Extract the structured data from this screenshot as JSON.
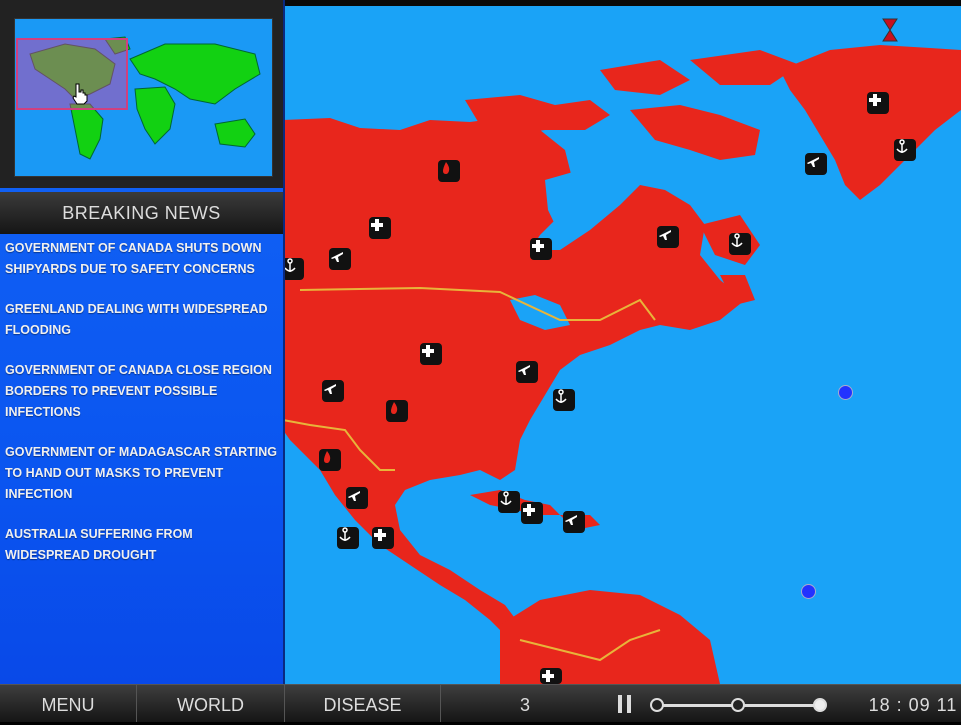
{
  "news": {
    "header": "BREAKING NEWS",
    "items": [
      "GOVERNMENT OF CANADA SHUTS DOWN SHIPYARDS DUE TO SAFETY CONCERNS",
      "GREENLAND DEALING WITH WIDESPREAD FLOODING",
      "GOVERNMENT OF CANADA CLOSE REGION BORDERS TO PREVENT POSSIBLE INFECTIONS",
      "GOVERNMENT OF MADAGASCAR STARTING TO HAND OUT MASKS TO PREVENT INFECTION",
      "AUSTRALIA SUFFERING FROM WIDESPREAD DROUGHT"
    ]
  },
  "bottom_bar": {
    "menu_label": "MENU",
    "world_label": "WORLD",
    "disease_label": "DISEASE",
    "day_value": "3",
    "clock": "18 : 09 11"
  },
  "colors": {
    "ocean": "#1aa3f7",
    "infected_land": "#e8261c",
    "healthy_land": "#12d112",
    "panel_blue": "#1467f7"
  },
  "map_icons": [
    "hospital-icon",
    "airport-icon",
    "seaport-icon",
    "fire-icon",
    "ship-icon",
    "hourglass-icon"
  ]
}
